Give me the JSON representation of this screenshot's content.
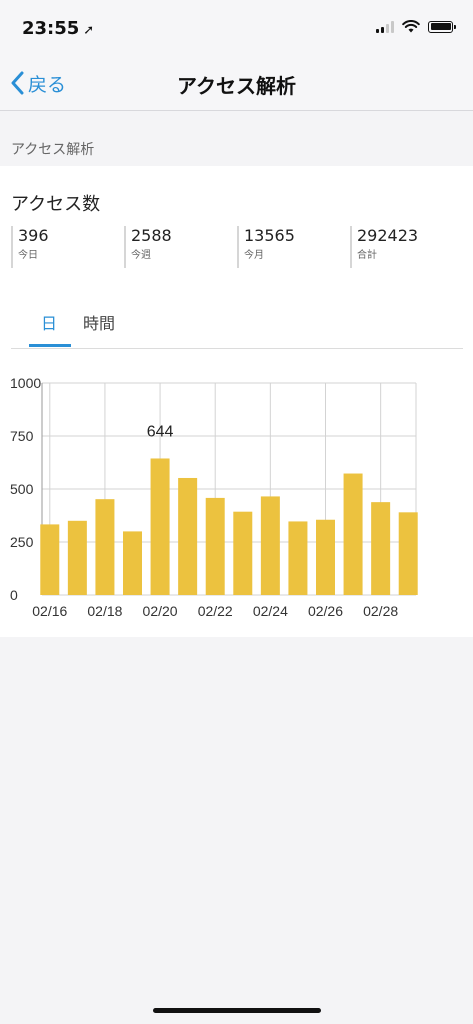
{
  "status": {
    "time": "23:55",
    "location_icon": "location-arrow-icon"
  },
  "nav": {
    "back_label": "戻る",
    "title": "アクセス解析"
  },
  "section": {
    "header": "アクセス解析"
  },
  "card": {
    "title": "アクセス数",
    "stats": [
      {
        "value": "396",
        "label": "今日"
      },
      {
        "value": "2588",
        "label": "今週"
      },
      {
        "value": "13565",
        "label": "今月"
      },
      {
        "value": "292423",
        "label": "合計"
      }
    ]
  },
  "tabs": [
    {
      "label": "日",
      "active": true
    },
    {
      "label": "時間",
      "active": false
    }
  ],
  "colors": {
    "accent": "#2a8fd6",
    "bar": "#ecc23f",
    "grid": "#d3d3d3"
  },
  "chart_data": {
    "type": "bar",
    "categories": [
      "02/16",
      "02/17",
      "02/18",
      "02/19",
      "02/20",
      "02/21",
      "02/22",
      "02/23",
      "02/24",
      "02/25",
      "02/26",
      "02/27",
      "02/28",
      "02/29"
    ],
    "values": [
      333,
      350,
      452,
      300,
      644,
      552,
      458,
      393,
      465,
      347,
      355,
      573,
      438,
      390
    ],
    "x_tick_labels": [
      "02/16",
      "02/18",
      "02/20",
      "02/22",
      "02/24",
      "02/26",
      "02/28"
    ],
    "y_ticks": [
      0,
      250,
      500,
      750,
      1000
    ],
    "ylim": [
      0,
      1000
    ],
    "annotation": {
      "category": "02/20",
      "text": "644"
    },
    "grid": true
  }
}
